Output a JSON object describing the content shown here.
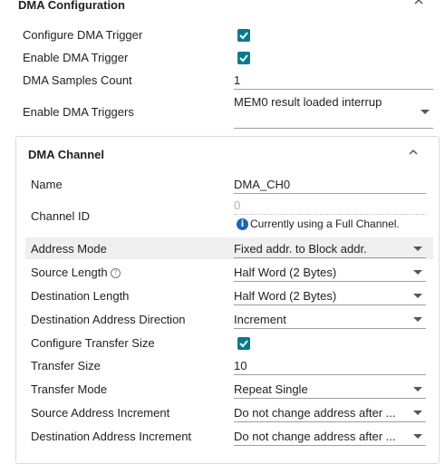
{
  "dma_config": {
    "title": "DMA Configuration",
    "configure_trigger_label": "Configure DMA Trigger",
    "configure_trigger_checked": true,
    "enable_trigger_label": "Enable DMA Trigger",
    "enable_trigger_checked": true,
    "samples_count_label": "DMA Samples Count",
    "samples_count_value": "1",
    "enable_triggers_label": "Enable DMA Triggers",
    "enable_triggers_value": "MEM0 result loaded interrup"
  },
  "dma_channel": {
    "title": "DMA Channel",
    "name_label": "Name",
    "name_value": "DMA_CH0",
    "channel_id_label": "Channel ID",
    "channel_id_value": "0",
    "channel_info": "Currently using a Full Channel.",
    "address_mode_label": "Address Mode",
    "address_mode_value": "Fixed addr. to Block addr.",
    "source_length_label": "Source Length",
    "source_length_value": "Half Word (2 Bytes)",
    "destination_length_label": "Destination Length",
    "destination_length_value": "Half Word (2 Bytes)",
    "dest_addr_direction_label": "Destination Address Direction",
    "dest_addr_direction_value": "Increment",
    "configure_transfer_size_label": "Configure Transfer Size",
    "configure_transfer_size_checked": true,
    "transfer_size_label": "Transfer Size",
    "transfer_size_value": "10",
    "transfer_mode_label": "Transfer Mode",
    "transfer_mode_value": "Repeat Single",
    "source_addr_increment_label": "Source Address Increment",
    "source_addr_increment_value": "Do not change address after ...",
    "dest_addr_increment_label": "Destination Address Increment",
    "dest_addr_increment_value": "Do not change address after ..."
  },
  "colors": {
    "checkbox": "#007c91",
    "info_icon": "#1565c0",
    "highlight_row": "#efefef"
  }
}
